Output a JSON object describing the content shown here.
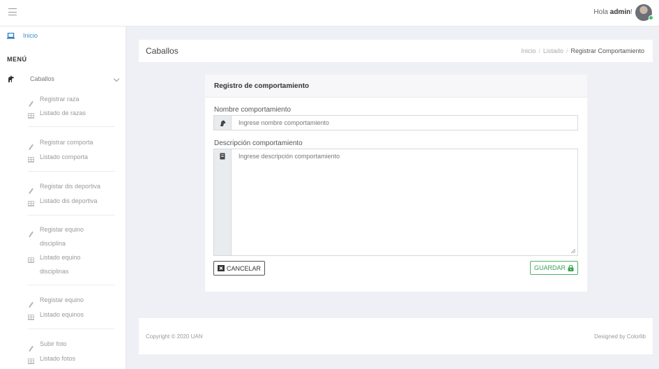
{
  "topbar": {
    "greeting": "Hola",
    "username": "admin",
    "greeting_suffix": "!"
  },
  "sidebar": {
    "home_label": "Inicio",
    "menu_title": "MENÚ",
    "group_label": "Caballos",
    "items": [
      {
        "icon": "pencil-icon",
        "label": "Registrar raza"
      },
      {
        "icon": "table-icon",
        "label": "Listado de razas"
      },
      {
        "icon": "pencil-icon",
        "label": "Registrar comporta"
      },
      {
        "icon": "table-icon",
        "label": "Listado comporta"
      },
      {
        "icon": "pencil-icon",
        "label": "Registar dis deportiva"
      },
      {
        "icon": "table-icon",
        "label": "Listado dis deportiva"
      },
      {
        "icon": "pencil-icon",
        "label": "Registar equino disciplina"
      },
      {
        "icon": "table-icon",
        "label": "Listado equino disciplinas"
      },
      {
        "icon": "pencil-icon",
        "label": "Registar equino"
      },
      {
        "icon": "table-icon",
        "label": "Listado equinos"
      },
      {
        "icon": "pencil-icon",
        "label": "Subir foto"
      },
      {
        "icon": "table-icon",
        "label": "Listado fotos"
      }
    ]
  },
  "header": {
    "title": "Caballos",
    "breadcrumb": [
      "Inicio",
      "Listado",
      "Registrar Comportamiento"
    ]
  },
  "form": {
    "title": "Registro de comportamiento",
    "name_label": "Nombre comportamiento",
    "name_placeholder": "Ingrese nombre comportamiento",
    "desc_label": "Descripción comportamiento",
    "desc_placeholder": "Ingrese descripción comportamiento",
    "cancel_label": "CANCELAR",
    "save_label": "GUARDAR"
  },
  "footer": {
    "copyright": "Copyright © 2020 UAN",
    "designed": "Designed by Colorlib"
  },
  "colors": {
    "accent": "#3d8ec6",
    "success": "#52b26b",
    "background": "#eef0f5",
    "online": "#3bc26a"
  }
}
